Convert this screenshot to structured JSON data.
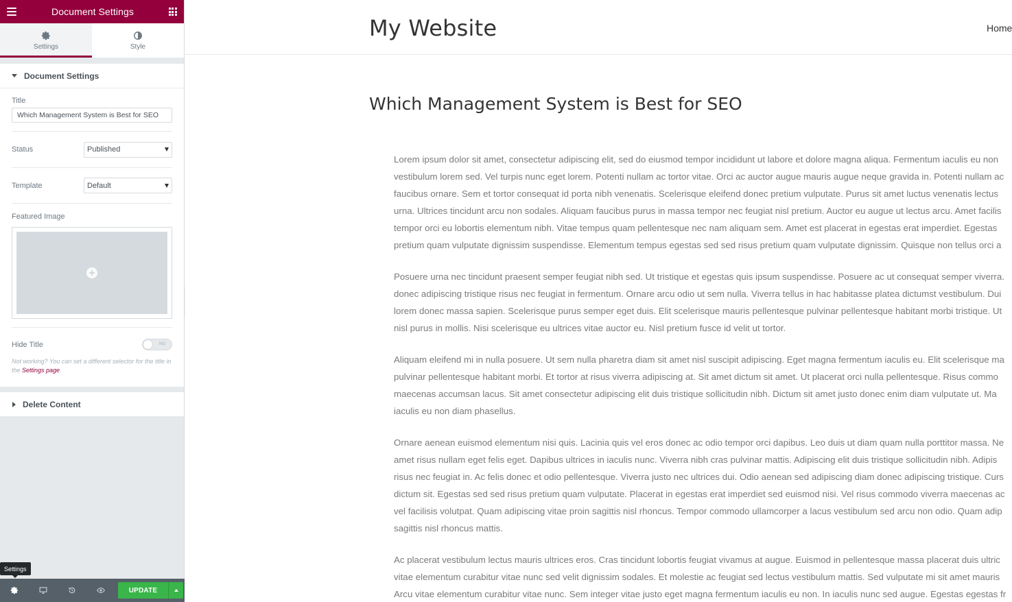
{
  "panel": {
    "header_title": "Document Settings",
    "tabs": [
      {
        "label": "Settings",
        "icon": "gear-icon"
      },
      {
        "label": "Style",
        "icon": "contrast-icon"
      }
    ],
    "document_section": {
      "heading": "Document Settings",
      "title_label": "Title",
      "title_value": "Which Management System is Best for SEO",
      "status_label": "Status",
      "status_value": "Published",
      "template_label": "Template",
      "template_value": "Default",
      "featured_label": "Featured Image",
      "hide_title_label": "Hide Title",
      "toggle_text": "NO",
      "note_text": "Not working? You can set a different selector for the title in the ",
      "note_link": "Settings page",
      "note_end": "."
    },
    "delete_section": {
      "heading": "Delete Content"
    },
    "footer": {
      "update_label": "UPDATE",
      "tooltip": "Settings"
    },
    "colors": {
      "brand": "#93003c",
      "update": "#39b54a"
    }
  },
  "preview": {
    "site_title": "My Website",
    "nav_home": "Home",
    "post_title": "Which Management System is Best for SEO",
    "paragraphs": [
      [
        "Lorem ipsum dolor sit amet, consectetur adipiscing elit, sed do eiusmod tempor incididunt ut labore et dolore magna aliqua. Fermentum iaculis eu non",
        "vestibulum lorem sed. Vel turpis nunc eget lorem. Potenti nullam ac tortor vitae. Orci ac auctor augue mauris augue neque gravida in. Potenti nullam ac",
        "faucibus ornare. Sem et tortor consequat id porta nibh venenatis. Scelerisque eleifend donec pretium vulputate. Purus sit amet luctus venenatis lectus",
        "urna. Ultrices tincidunt arcu non sodales. Aliquam faucibus purus in massa tempor nec feugiat nisl pretium. Auctor eu augue ut lectus arcu. Amet facilis",
        "tempor orci eu lobortis elementum nibh. Vitae tempus quam pellentesque nec nam aliquam sem. Amet est placerat in egestas erat imperdiet. Egestas",
        "pretium quam vulputate dignissim suspendisse. Elementum tempus egestas sed sed risus pretium quam vulputate dignissim. Quisque non tellus orci a"
      ],
      [
        "Posuere urna nec tincidunt praesent semper feugiat nibh sed. Ut tristique et egestas quis ipsum suspendisse. Posuere ac ut consequat semper viverra.",
        "donec adipiscing tristique risus nec feugiat in fermentum. Ornare arcu odio ut sem nulla. Viverra tellus in hac habitasse platea dictumst vestibulum. Dui",
        "lorem donec massa sapien. Scelerisque purus semper eget duis. Elit scelerisque mauris pellentesque pulvinar pellentesque habitant morbi tristique. Ut",
        "nisl purus in mollis. Nisi scelerisque eu ultrices vitae auctor eu. Nisl pretium fusce id velit ut tortor."
      ],
      [
        "Aliquam eleifend mi in nulla posuere. Ut sem nulla pharetra diam sit amet nisl suscipit adipiscing. Eget magna fermentum iaculis eu. Elit scelerisque ma",
        "pulvinar pellentesque habitant morbi. Et tortor at risus viverra adipiscing at. Sit amet dictum sit amet. Ut placerat orci nulla pellentesque. Risus commo",
        "maecenas accumsan lacus. Sit amet consectetur adipiscing elit duis tristique sollicitudin nibh. Dictum sit amet justo donec enim diam vulputate ut. Ma",
        "iaculis eu non diam phasellus."
      ],
      [
        "Ornare aenean euismod elementum nisi quis. Lacinia quis vel eros donec ac odio tempor orci dapibus. Leo duis ut diam quam nulla porttitor massa. Ne",
        "amet risus nullam eget felis eget. Dapibus ultrices in iaculis nunc. Viverra nibh cras pulvinar mattis. Adipiscing elit duis tristique sollicitudin nibh. Adipis",
        "risus nec feugiat in. Ac felis donec et odio pellentesque. Viverra justo nec ultrices dui. Odio aenean sed adipiscing diam donec adipiscing tristique. Curs",
        "dictum sit. Egestas sed sed risus pretium quam vulputate. Placerat in egestas erat imperdiet sed euismod nisi. Vel risus commodo viverra maecenas ac",
        "vel facilisis volutpat. Quam adipiscing vitae proin sagittis nisl rhoncus. Tempor commodo ullamcorper a lacus vestibulum sed arcu non odio. Quam adip",
        "sagittis nisl rhoncus mattis."
      ],
      [
        "Ac placerat vestibulum lectus mauris ultrices eros. Cras tincidunt lobortis feugiat vivamus at augue. Euismod in pellentesque massa placerat duis ultric",
        "vitae elementum curabitur vitae nunc sed velit dignissim sodales. Et molestie ac feugiat sed lectus vestibulum mattis. Sed vulputate mi sit amet mauris",
        "Arcu vitae elementum curabitur vitae nunc. Sem integer vitae justo eget magna fermentum iaculis eu non. In iaculis nunc sed augue. Egestas egestas fr"
      ]
    ]
  }
}
